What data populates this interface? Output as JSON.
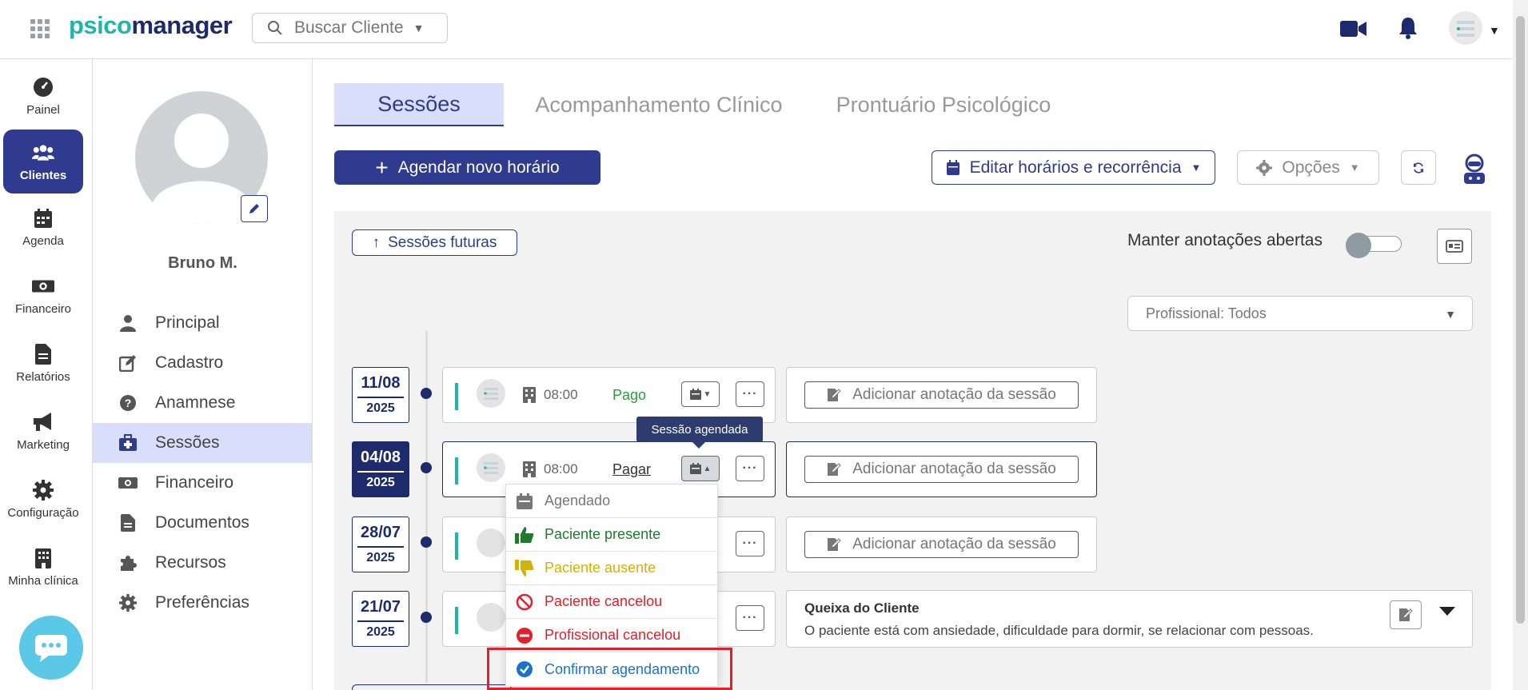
{
  "app": {
    "logo_part1": "psico",
    "logo_part2": "manager",
    "search_placeholder": "Buscar Cliente"
  },
  "leftnav": {
    "items": [
      {
        "label": "Painel",
        "icon": "dashboard-icon"
      },
      {
        "label": "Clientes",
        "icon": "users-icon",
        "active": true
      },
      {
        "label": "Agenda",
        "icon": "calendar-icon"
      },
      {
        "label": "Financeiro",
        "icon": "money-icon"
      },
      {
        "label": "Relatórios",
        "icon": "report-icon"
      },
      {
        "label": "Marketing",
        "icon": "megaphone-icon"
      },
      {
        "label": "Configuração",
        "icon": "gear-icon"
      },
      {
        "label": "Minha clínica",
        "icon": "building-icon"
      }
    ]
  },
  "client": {
    "name": "Bruno M.",
    "menu": [
      {
        "label": "Principal",
        "icon": "user-icon"
      },
      {
        "label": "Cadastro",
        "icon": "edit-icon"
      },
      {
        "label": "Anamnese",
        "icon": "question-icon"
      },
      {
        "label": "Sessões",
        "icon": "medical-kit-icon",
        "active": true
      },
      {
        "label": "Financeiro",
        "icon": "money-icon"
      },
      {
        "label": "Documentos",
        "icon": "document-icon"
      },
      {
        "label": "Recursos",
        "icon": "puzzle-icon"
      },
      {
        "label": "Preferências",
        "icon": "gear-icon"
      }
    ]
  },
  "tabs": [
    {
      "label": "Sessões",
      "active": true
    },
    {
      "label": "Acompanhamento Clínico"
    },
    {
      "label": "Prontuário Psicológico"
    }
  ],
  "toolbar": {
    "new_schedule": "Agendar novo horário",
    "edit_schedule": "Editar horários e recorrência",
    "options": "Opções"
  },
  "panel": {
    "future_sessions": "Sessões futuras",
    "keep_notes_open": "Manter anotações abertas",
    "professional_filter": "Profissional: Todos"
  },
  "sessions": [
    {
      "day": "11/08",
      "year": "2025",
      "time": "08:00",
      "payment": "Pago",
      "note_button": "Adicionar anotação da sessão"
    },
    {
      "day": "04/08",
      "year": "2025",
      "time": "08:00",
      "payment": "Pagar",
      "note_button": "Adicionar anotação da sessão",
      "active": true
    },
    {
      "day": "28/07",
      "year": "2025",
      "note_button": "Adicionar anotação da sessão"
    },
    {
      "day": "21/07",
      "year": "2025",
      "queixa_title": "Queixa do Cliente",
      "queixa_text": "O paciente está com ansiedade, dificuldade para dormir, se relacionar com pessoas."
    }
  ],
  "tooltip": "Sessão agendada",
  "status_menu": [
    {
      "label": "Agendado",
      "color": "#777777"
    },
    {
      "label": "Paciente presente",
      "color": "#1f7a2e"
    },
    {
      "label": "Paciente ausente",
      "color": "#d4b106"
    },
    {
      "label": "Paciente cancelou",
      "color": "#e0202a"
    },
    {
      "label": "Profissional cancelou",
      "color": "#e0202a"
    },
    {
      "label": "Confirmar agendamento",
      "color": "#1a73c8"
    }
  ],
  "colors": {
    "primary": "#2e3b8e",
    "accent": "#1fb5ad",
    "highlight": "#e0202a"
  }
}
